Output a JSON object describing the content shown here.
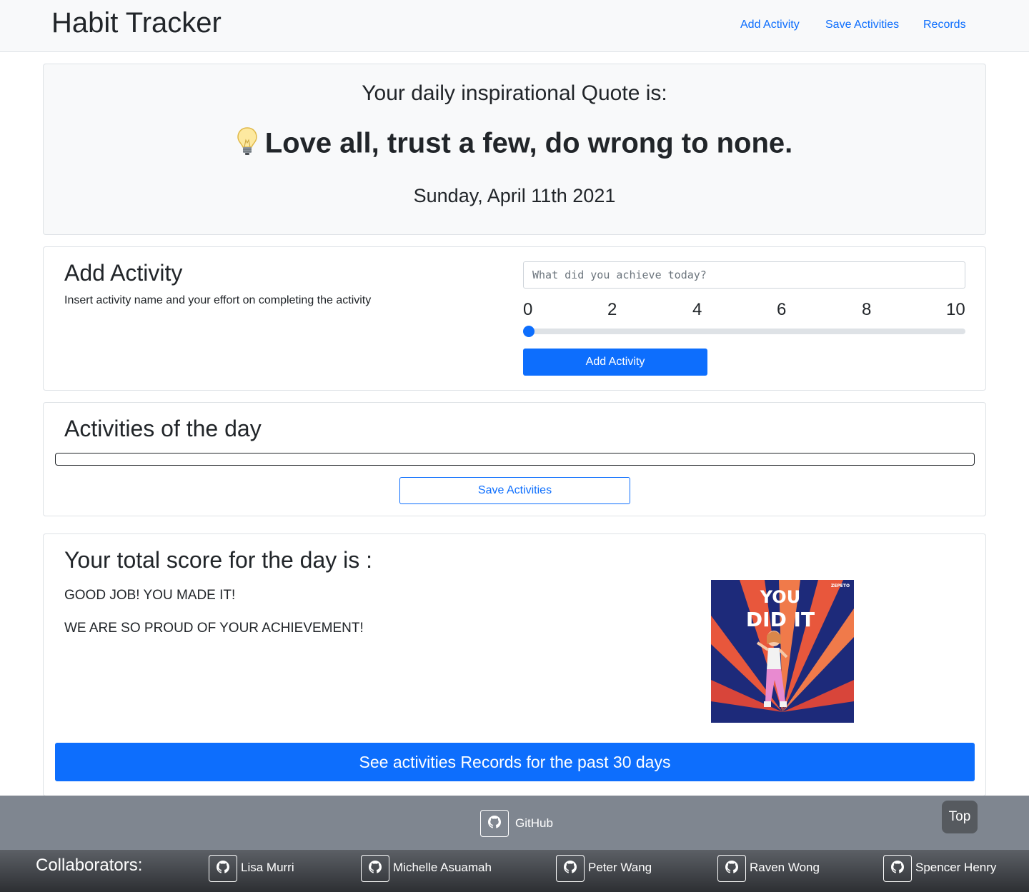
{
  "navbar": {
    "brand": "Habit Tracker",
    "links": [
      "Add Activity",
      "Save Activities",
      "Records"
    ]
  },
  "quote": {
    "intro": "Your daily inspirational Quote is:",
    "text": "Love all, trust a few, do wrong to none.",
    "date": "Sunday, April 11th 2021"
  },
  "add_activity": {
    "title": "Add Activity",
    "description": "Insert activity name and your effort on completing the activity",
    "placeholder": "What did you achieve today?",
    "ticks": [
      "0",
      "2",
      "4",
      "6",
      "8",
      "10"
    ],
    "slider_value": 0,
    "button": "Add Activity"
  },
  "activities": {
    "title": "Activities of the day",
    "save_button": "Save Activities"
  },
  "score": {
    "title": "Your total score for the day is :",
    "message1": "GOOD JOB! YOU MADE IT!",
    "message2": "WE ARE SO PROUD OF YOUR ACHIEVEMENT!",
    "image_text_line1": "YOU",
    "image_text_line2": "DID IT",
    "image_brand": "ZEPETO",
    "records_button": "See activities Records for the past 30 days"
  },
  "footer": {
    "github": "GitHub",
    "top_button": "Top",
    "collaborators_label": "Collaborators:",
    "collaborators": [
      "Lisa Murri",
      "Michelle Asuamah",
      "Peter Wang",
      "Raven Wong",
      "Spencer Henry"
    ]
  }
}
